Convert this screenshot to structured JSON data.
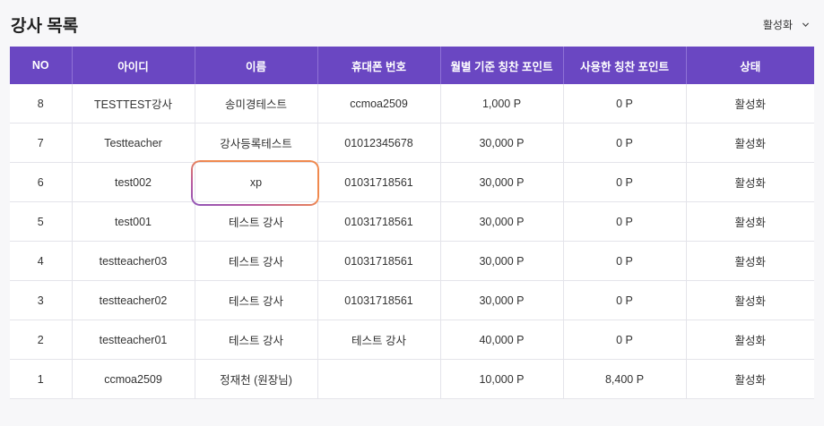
{
  "header": {
    "title": "강사 목록",
    "status_filter": "활성화"
  },
  "table": {
    "columns": [
      "NO",
      "아이디",
      "이름",
      "휴대폰 번호",
      "월별 기준 칭찬 포인트",
      "사용한 칭찬 포인트",
      "상태"
    ],
    "rows": [
      {
        "no": "8",
        "id": "TESTTEST강사",
        "name": "송미경테스트",
        "phone": "ccmoa2509",
        "monthly_points": "1,000 P",
        "used_points": "0 P",
        "status": "활성화"
      },
      {
        "no": "7",
        "id": "Testteacher",
        "name": "강사등록테스트",
        "phone": "01012345678",
        "monthly_points": "30,000 P",
        "used_points": "0 P",
        "status": "활성화"
      },
      {
        "no": "6",
        "id": "test002",
        "name": "xp",
        "phone": "01031718561",
        "monthly_points": "30,000 P",
        "used_points": "0 P",
        "status": "활성화"
      },
      {
        "no": "5",
        "id": "test001",
        "name": "테스트 강사",
        "phone": "01031718561",
        "monthly_points": "30,000 P",
        "used_points": "0 P",
        "status": "활성화"
      },
      {
        "no": "4",
        "id": "testteacher03",
        "name": "테스트 강사",
        "phone": "01031718561",
        "monthly_points": "30,000 P",
        "used_points": "0 P",
        "status": "활성화"
      },
      {
        "no": "3",
        "id": "testteacher02",
        "name": "테스트 강사",
        "phone": "01031718561",
        "monthly_points": "30,000 P",
        "used_points": "0 P",
        "status": "활성화"
      },
      {
        "no": "2",
        "id": "testteacher01",
        "name": "테스트 강사",
        "phone": "테스트 강사",
        "monthly_points": "40,000 P",
        "used_points": "0 P",
        "status": "활성화"
      },
      {
        "no": "1",
        "id": "ccmoa2509",
        "name": "정재천 (원장님)",
        "phone": "",
        "monthly_points": "10,000 P",
        "used_points": "8,400 P",
        "status": "활성화"
      }
    ]
  },
  "colors": {
    "header_bg": "#6a47c2",
    "highlight_start": "#f0894e",
    "highlight_end": "#8e55b8"
  }
}
